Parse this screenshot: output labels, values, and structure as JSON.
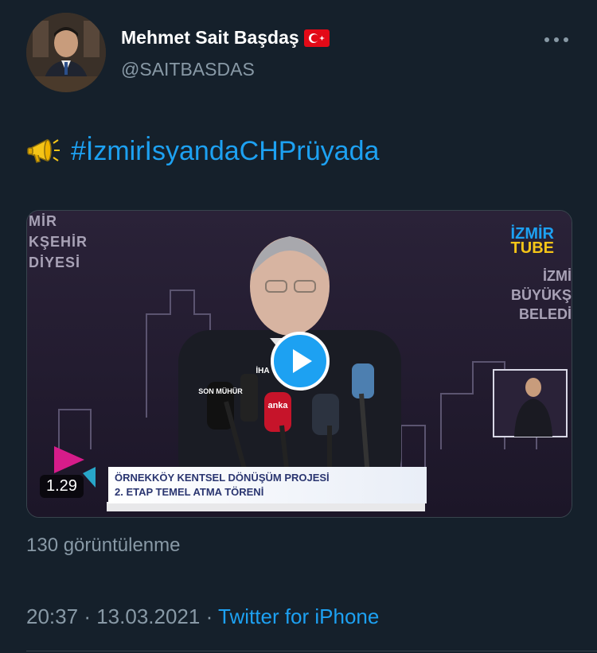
{
  "author": {
    "name": "Mehmet Sait Başdaş",
    "handle": "@SAITBASDAS",
    "flag_icon": "turkey-flag-icon"
  },
  "tweet": {
    "emoji_icon": "megaphone-icon",
    "hashtag": "#İzmirİsyandaCHPrüyada"
  },
  "media": {
    "duration": "1.29",
    "caption_line1": "ÖRNEKKÖY KENTSEL DÖNÜŞÜM PROJESİ",
    "caption_line2": "2. ETAP TEMEL ATMA TÖRENİ",
    "watermark_left": [
      "MİR",
      "KŞEHİR",
      "DİYESİ"
    ],
    "watermark_right": [
      "İZMİ",
      "BÜYÜKŞ",
      "BELEDİ"
    ],
    "brand_line1": "İZMİR",
    "brand_line2": "TUBE",
    "mic_labels": [
      "SON MÜHÜR",
      "anka",
      "İHA"
    ]
  },
  "stats": {
    "views": "130 görüntülenme"
  },
  "meta": {
    "time": "20:37",
    "separator": "·",
    "date": "13.03.2021",
    "source": "Twitter for iPhone"
  },
  "colors": {
    "background": "#15202b",
    "accent": "#1da1f2",
    "secondary_text": "#8899a6"
  }
}
